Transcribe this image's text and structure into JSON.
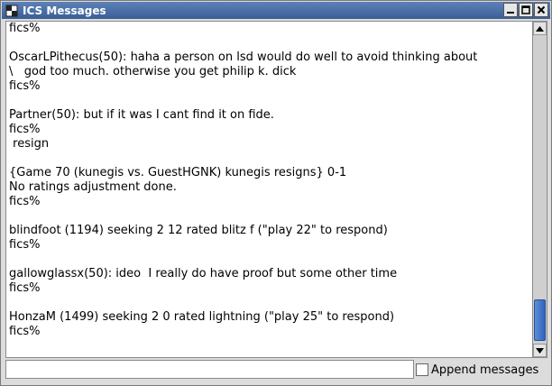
{
  "window": {
    "title": "ICS Messages",
    "icon": "chess-icon"
  },
  "messages": [
    "fics%",
    "",
    "OscarLPithecus(50): haha a person on lsd would do well to avoid thinking about",
    "\\   god too much. otherwise you get philip k. dick",
    "fics%",
    "",
    "Partner(50): but if it was I cant find it on fide.",
    "fics%",
    " resign",
    "",
    "{Game 70 (kunegis vs. GuestHGNK) kunegis resigns} 0-1",
    "No ratings adjustment done.",
    "fics%",
    "",
    "blindfoot (1194) seeking 2 12 rated blitz f (\"play 22\" to respond)",
    "fics%",
    "",
    "gallowglassx(50): ideo  I really do have proof but some other time",
    "fics%",
    "",
    "HonzaM (1499) seeking 2 0 rated lightning (\"play 25\" to respond)",
    "fics%"
  ],
  "input": {
    "value": ""
  },
  "append_checkbox": {
    "label": "Append messages",
    "checked": false
  },
  "scrollbar": {
    "position": "bottom"
  },
  "colors": {
    "titlebar": "#3a5e95",
    "scroll_thumb": "#2f63c0"
  }
}
